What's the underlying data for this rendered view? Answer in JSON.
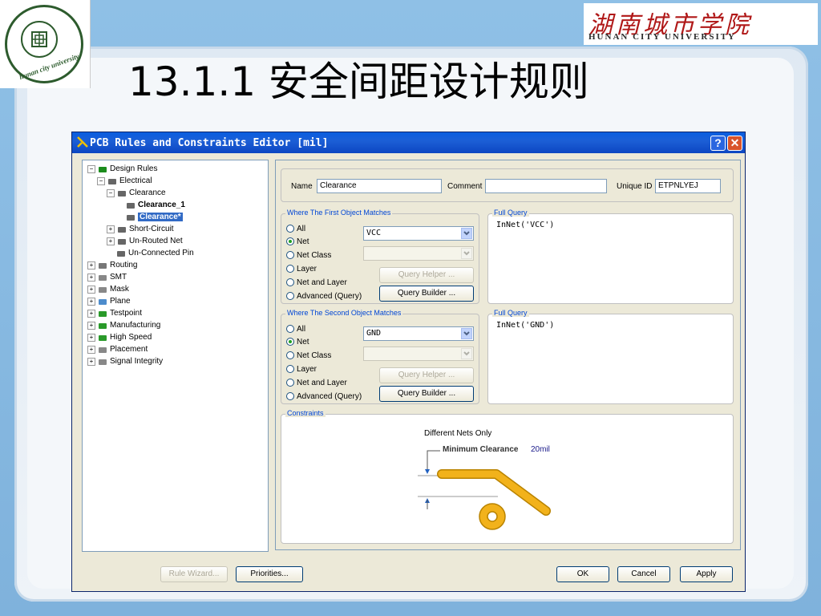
{
  "slide": {
    "title": "13.1.1  安全间距设计规则",
    "university_cn": "湖南城市学院",
    "university_en": "HUNAN CITY UNIVERSITY",
    "logo_text": "hunan city university"
  },
  "dialog": {
    "title": "PCB Rules and Constraints Editor [mil]",
    "help_label": "?",
    "close_label": "✕"
  },
  "tree": [
    {
      "label": "Design Rules",
      "expander": "−",
      "icon": "design-rules-icon"
    },
    {
      "label": "Electrical",
      "expander": "−",
      "icon": "electrical-icon"
    },
    {
      "label": "Clearance",
      "expander": "−",
      "icon": "clearance-icon"
    },
    {
      "label": "Clearance_1",
      "expander": "",
      "icon": "rule-icon",
      "bold": true
    },
    {
      "label": "Clearance*",
      "expander": "",
      "icon": "rule-icon",
      "bold": true,
      "selected": true
    },
    {
      "label": "Short-Circuit",
      "expander": "+",
      "icon": "short-circuit-icon"
    },
    {
      "label": "Un-Routed Net",
      "expander": "+",
      "icon": "unrouted-net-icon"
    },
    {
      "label": "Un-Connected Pin",
      "expander": "",
      "icon": "unconnected-pin-icon"
    },
    {
      "label": "Routing",
      "expander": "+",
      "icon": "routing-icon"
    },
    {
      "label": "SMT",
      "expander": "+",
      "icon": "smt-icon"
    },
    {
      "label": "Mask",
      "expander": "+",
      "icon": "mask-icon"
    },
    {
      "label": "Plane",
      "expander": "+",
      "icon": "plane-icon"
    },
    {
      "label": "Testpoint",
      "expander": "+",
      "icon": "testpoint-icon"
    },
    {
      "label": "Manufacturing",
      "expander": "+",
      "icon": "manufacturing-icon"
    },
    {
      "label": "High Speed",
      "expander": "+",
      "icon": "high-speed-icon"
    },
    {
      "label": "Placement",
      "expander": "+",
      "icon": "placement-icon"
    },
    {
      "label": "Signal Integrity",
      "expander": "+",
      "icon": "signal-integrity-icon"
    }
  ],
  "rule": {
    "name_label": "Name",
    "name_value": "Clearance",
    "comment_label": "Comment",
    "comment_value": "",
    "unique_id_label": "Unique ID",
    "unique_id_value": "ETPNLYEJ"
  },
  "first": {
    "group_label": "Where The First Object Matches",
    "options": [
      "All",
      "Net",
      "Net Class",
      "Layer",
      "Net and Layer",
      "Advanced (Query)"
    ],
    "selected": "Net",
    "net_value": "VCC",
    "query_helper": "Query Helper ...",
    "query_builder": "Query Builder ...",
    "full_query_label": "Full Query",
    "full_query": "InNet('VCC')"
  },
  "second": {
    "group_label": "Where The Second Object Matches",
    "options": [
      "All",
      "Net",
      "Net Class",
      "Layer",
      "Net and Layer",
      "Advanced (Query)"
    ],
    "selected": "Net",
    "net_value": "GND",
    "query_helper": "Query Helper ...",
    "query_builder": "Query Builder ...",
    "full_query_label": "Full Query",
    "full_query": "InNet('GND')"
  },
  "constraints": {
    "group_label": "Constraints",
    "scope": "Different Nets Only",
    "min_clearance_label": "Minimum Clearance",
    "min_clearance_value": "20mil"
  },
  "footer": {
    "rule_wizard": "Rule Wizard...",
    "priorities": "Priorities...",
    "ok": "OK",
    "cancel": "Cancel",
    "apply": "Apply"
  },
  "colors": {
    "titlebar": "#0a5ee0",
    "selection": "#316ac5",
    "trace": "#f2b21b",
    "group_label": "#0046d5"
  }
}
